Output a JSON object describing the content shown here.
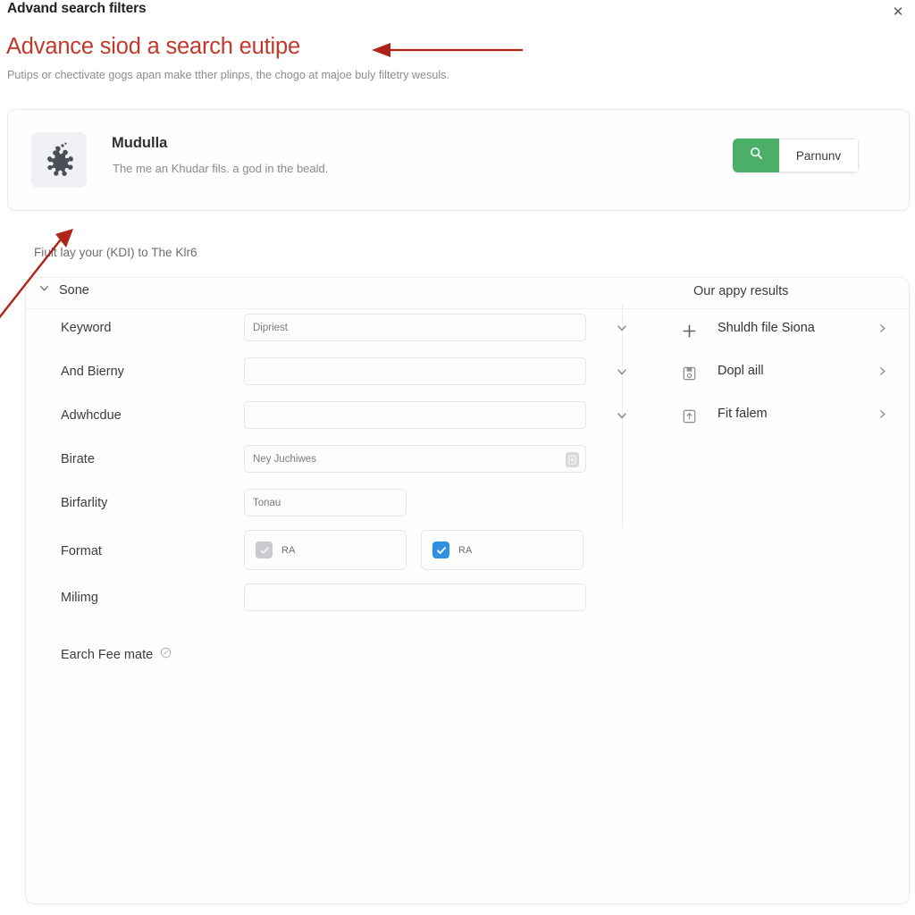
{
  "window": {
    "title": "Advand search filters",
    "close_label": "✕"
  },
  "hero": {
    "title": "Advance siod a search eutipe",
    "subtitle": "Putips or chectivate gogs apan make tther plinps, the chogo at majoe buly filtetry wesuls."
  },
  "banner": {
    "icon": "puzzle-piece-icon",
    "title": "Mudulla",
    "description": "The me an Khudar fils. a god in the beald.",
    "search_icon": "magnifier-icon",
    "action_label": "Parnunv",
    "accent_green": "#4caf68"
  },
  "panel": {
    "caption": "Fiult lay your (KDI) to The Klr6",
    "accordion": {
      "label": "Sone",
      "chevron": "chevron-down-icon",
      "expanded": true
    },
    "form_rows": [
      {
        "label": "Keyword",
        "value": "Dipriest",
        "placeholder": "",
        "control": "select",
        "width": "wide"
      },
      {
        "label": "And Bierny",
        "value": "",
        "placeholder": "",
        "control": "select",
        "width": "wide"
      },
      {
        "label": "Adwhcdue",
        "value": "",
        "placeholder": "",
        "control": "select",
        "width": "wide"
      },
      {
        "label": "Birate",
        "value": "Ney Juchiwes",
        "placeholder": "",
        "control": "text-icon",
        "width": "wide"
      },
      {
        "label": "Birfarlity",
        "value": "Tonau",
        "placeholder": "",
        "control": "text",
        "width": "mid"
      }
    ],
    "format_row": {
      "label": "Format",
      "options": [
        {
          "label": "RA",
          "checked": false
        },
        {
          "label": "RA",
          "checked": true
        }
      ],
      "checked_color": "#2f8fe0",
      "unchecked_color": "#c8cacd"
    },
    "last_row": {
      "label": "Milimg",
      "value": "",
      "placeholder": ""
    },
    "footnote": {
      "label": "Earch Fee mate",
      "icon": "info-icon"
    },
    "results": {
      "header": "Our appy results",
      "items": [
        {
          "icon": "plus-icon",
          "label": "Shuldh file Siona",
          "chevron": "chevron-right-icon"
        },
        {
          "icon": "save-icon",
          "label": "Dopl aill",
          "chevron": "chevron-right-icon"
        },
        {
          "icon": "upload-icon",
          "label": "Fit falem",
          "chevron": "chevron-right-icon"
        }
      ]
    }
  },
  "annotations": {
    "arrow_color": "#b02318",
    "arrow_1": "points-left-at-hero-title",
    "arrow_2": "points-up-right-at-panel-caption"
  }
}
